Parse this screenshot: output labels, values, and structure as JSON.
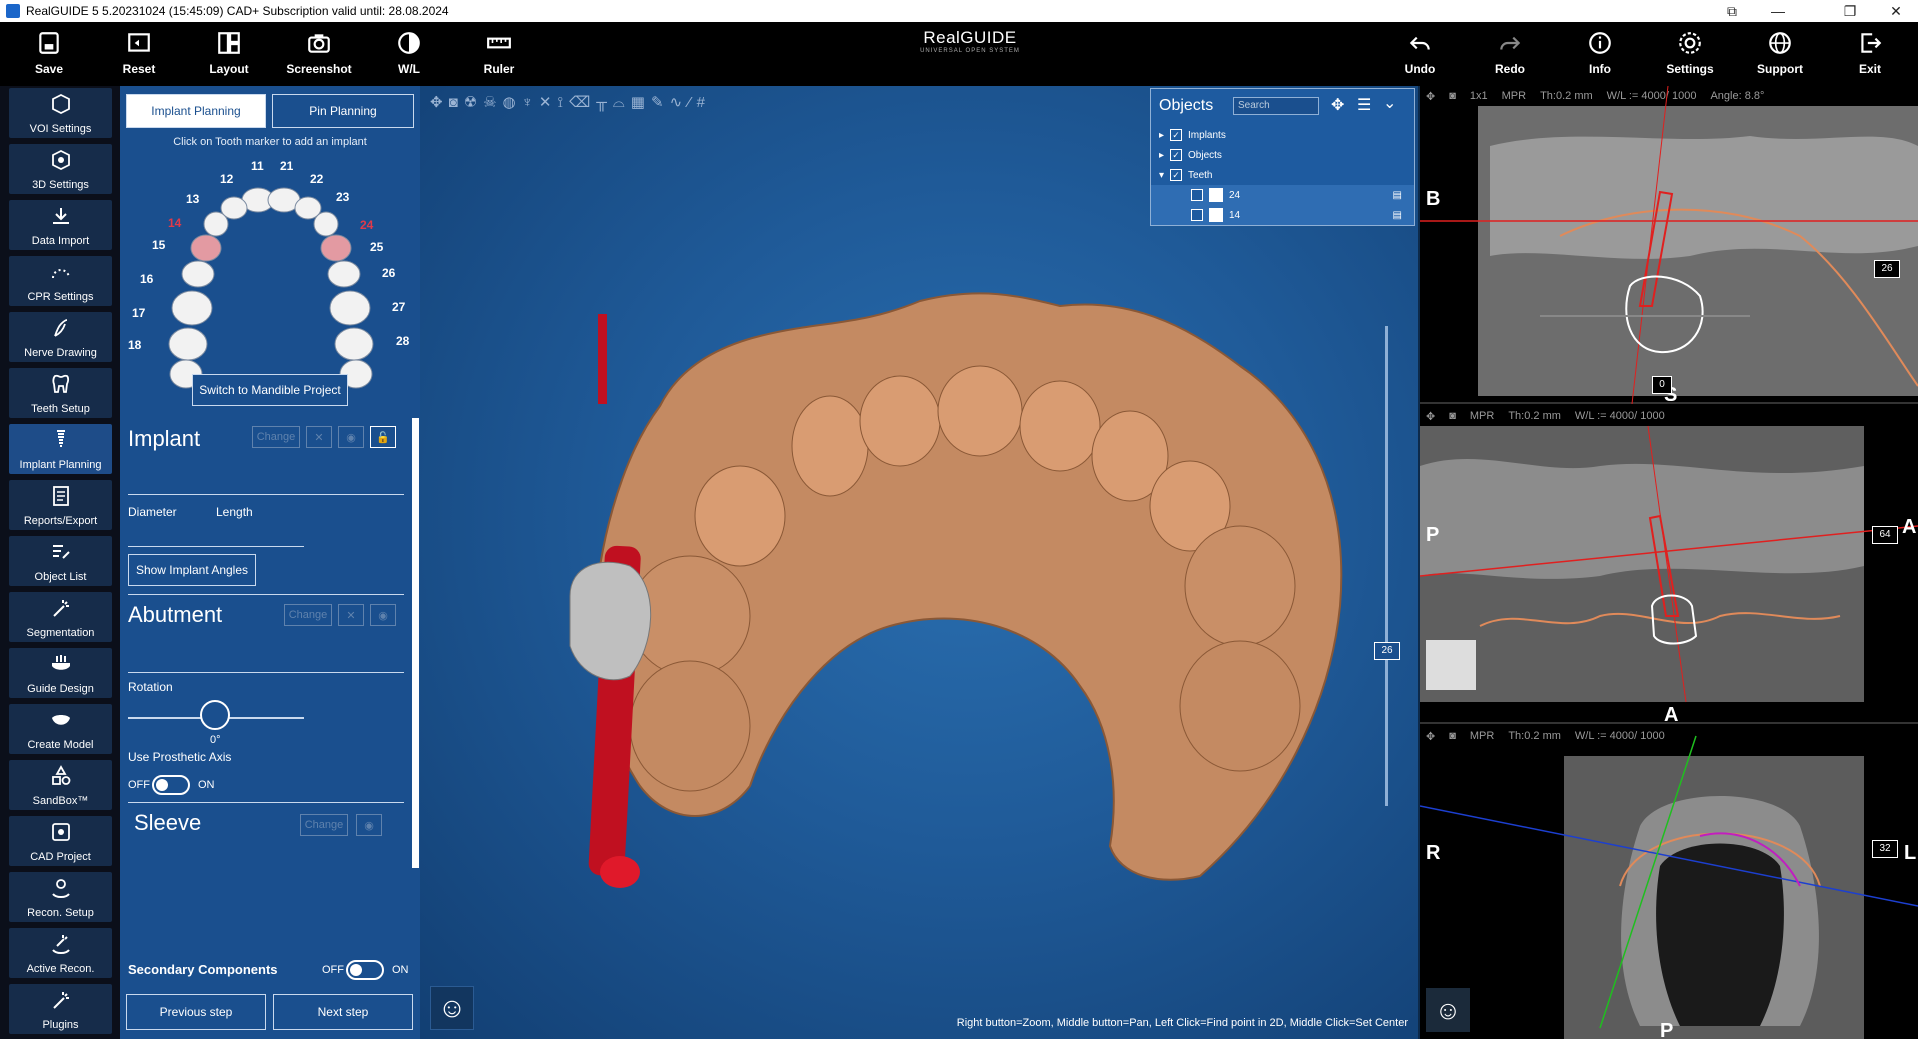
{
  "window": {
    "title": "RealGUIDE 5  5.20231024 (15:45:09)  CAD+ Subscription valid until: 28.08.2024"
  },
  "toolbar": {
    "left": [
      {
        "label": "Save",
        "icon": "save-icon"
      },
      {
        "label": "Reset",
        "icon": "reset-icon"
      },
      {
        "label": "Layout",
        "icon": "layout-icon"
      },
      {
        "label": "Screenshot",
        "icon": "camera-icon"
      },
      {
        "label": "W/L",
        "icon": "contrast-icon"
      },
      {
        "label": "Ruler",
        "icon": "ruler-icon"
      }
    ],
    "right": [
      {
        "label": "Undo",
        "icon": "undo-icon"
      },
      {
        "label": "Redo",
        "icon": "redo-icon"
      },
      {
        "label": "Info",
        "icon": "info-icon"
      },
      {
        "label": "Settings",
        "icon": "gear-icon"
      },
      {
        "label": "Support",
        "icon": "globe-icon"
      },
      {
        "label": "Exit",
        "icon": "exit-icon"
      }
    ],
    "brand": {
      "name": "RealGUIDE",
      "tagline": "UNIVERSAL OPEN SYSTEM"
    }
  },
  "sidebar": {
    "items": [
      {
        "label": "VOI Settings"
      },
      {
        "label": "3D Settings"
      },
      {
        "label": "Data Import"
      },
      {
        "label": "CPR Settings"
      },
      {
        "label": "Nerve Drawing"
      },
      {
        "label": "Teeth Setup"
      },
      {
        "label": "Implant Planning",
        "active": true
      },
      {
        "label": "Reports/Export"
      },
      {
        "label": "Object List"
      },
      {
        "label": "Segmentation"
      },
      {
        "label": "Guide Design"
      },
      {
        "label": "Create Model"
      },
      {
        "label": "SandBox™"
      },
      {
        "label": "CAD Project"
      },
      {
        "label": "Recon. Setup"
      },
      {
        "label": "Active Recon."
      },
      {
        "label": "Plugins"
      }
    ]
  },
  "panel": {
    "tabs": [
      "Implant Planning",
      "Pin Planning"
    ],
    "hint": "Click on Tooth marker to add an implant",
    "teeth": [
      "11",
      "21",
      "12",
      "22",
      "13",
      "23",
      "14",
      "24",
      "15",
      "25",
      "16",
      "26",
      "17",
      "27",
      "18",
      "28"
    ],
    "switch_btn": "Switch to Mandible Project",
    "implant": {
      "title": "Implant",
      "change": "Change",
      "diameter": "Diameter",
      "length": "Length",
      "angles_btn": "Show Implant Angles"
    },
    "abutment": {
      "title": "Abutment",
      "change": "Change",
      "rotation": "Rotation",
      "rotation_value": "0°",
      "prosthetic": "Use Prosthetic Axis",
      "off": "OFF",
      "on": "ON"
    },
    "sleeve": {
      "title": "Sleeve",
      "change": "Change"
    },
    "secondary": {
      "label": "Secondary Components",
      "off": "OFF",
      "on": "ON"
    },
    "prev": "Previous step",
    "next": "Next step"
  },
  "viewport": {
    "status": "Right button=Zoom, Middle button=Pan, Left Click=Find point in 2D, Middle Click=Set Center",
    "slider_value": "26"
  },
  "objects": {
    "title": "Objects",
    "search_placeholder": "Search",
    "rows": [
      {
        "label": "Implants"
      },
      {
        "label": "Objects"
      },
      {
        "label": "Teeth"
      },
      {
        "label": "24"
      },
      {
        "label": "14"
      }
    ]
  },
  "panes": [
    {
      "head": [
        "1x1",
        "MPR",
        "Th:0.2 mm",
        "W/L := 4000/ 1000",
        "Angle: 8.8°"
      ],
      "left": "B",
      "bottom": "S",
      "slider": "26",
      "hslider": "0"
    },
    {
      "head": [
        "MPR",
        "Th:0.2 mm",
        "W/L := 4000/ 1000"
      ],
      "left": "P",
      "right": "A",
      "bottom": "A",
      "slider": "64"
    },
    {
      "head": [
        "MPR",
        "Th:0.2 mm",
        "W/L := 4000/ 1000"
      ],
      "left": "R",
      "right": "L",
      "bottom": "P",
      "slider": "32"
    }
  ],
  "colors": {
    "accent": "#1a4f8e",
    "sidebar_active": "#1e4c88",
    "implant_red": "#c01020",
    "tooth_marker": "#e39aa2"
  }
}
